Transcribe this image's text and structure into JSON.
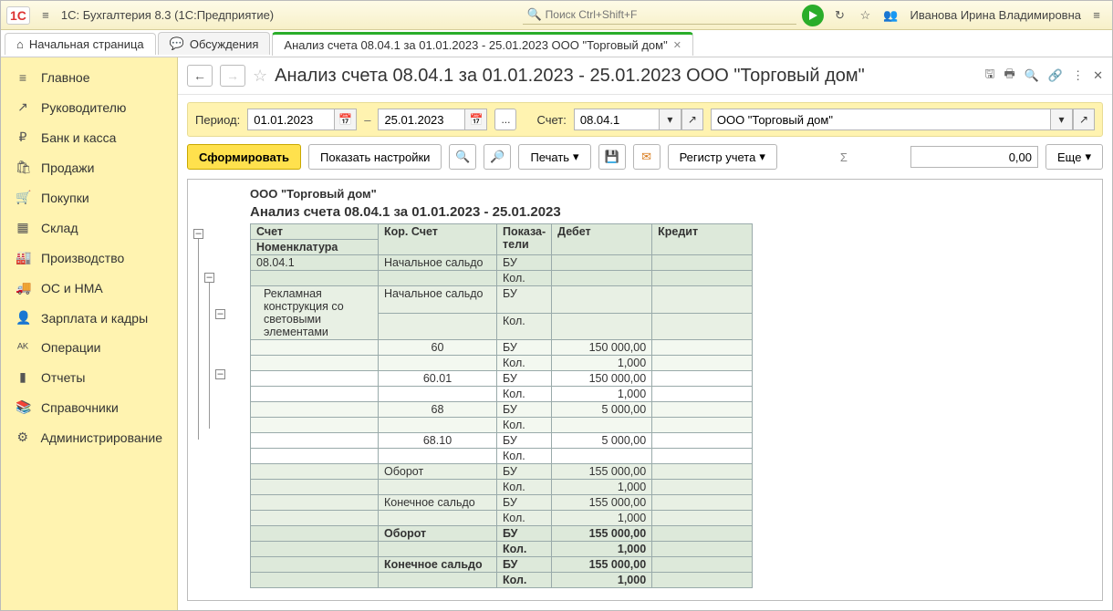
{
  "top": {
    "app_title": "1С: Бухгалтерия 8.3  (1С:Предприятие)",
    "search_placeholder": "Поиск Ctrl+Shift+F",
    "user": "Иванова Ирина Владимировна"
  },
  "tabs": {
    "start": "Начальная страница",
    "discuss": "Обсуждения",
    "active": "Анализ счета 08.04.1 за 01.01.2023 - 25.01.2023 ООО \"Торговый дом\""
  },
  "sidebar": [
    {
      "icon": "≡",
      "label": "Главное"
    },
    {
      "icon": "↗",
      "label": "Руководителю"
    },
    {
      "icon": "₽",
      "label": "Банк и касса"
    },
    {
      "icon": "🛍",
      "label": "Продажи"
    },
    {
      "icon": "🛒",
      "label": "Покупки"
    },
    {
      "icon": "▦",
      "label": "Склад"
    },
    {
      "icon": "🏭",
      "label": "Производство"
    },
    {
      "icon": "🚚",
      "label": "ОС и НМА"
    },
    {
      "icon": "👤",
      "label": "Зарплата и кадры"
    },
    {
      "icon": "ᴬᴷ",
      "label": "Операции"
    },
    {
      "icon": "▮",
      "label": "Отчеты"
    },
    {
      "icon": "📚",
      "label": "Справочники"
    },
    {
      "icon": "⚙",
      "label": "Администрирование"
    }
  ],
  "doc": {
    "title": "Анализ счета 08.04.1 за 01.01.2023 - 25.01.2023 ООО \"Торговый дом\"",
    "period_label": "Период:",
    "date_from": "01.01.2023",
    "date_to": "25.01.2023",
    "dash": "–",
    "ellipsis": "...",
    "account_label": "Счет:",
    "account": "08.04.1",
    "org": "ООО \"Торговый дом\""
  },
  "cmd": {
    "form": "Сформировать",
    "show_settings": "Показать настройки",
    "print": "Печать",
    "register": "Регистр учета",
    "more": "Еще",
    "sum": "0,00"
  },
  "report": {
    "org_title": "ООО \"Торговый дом\"",
    "title": "Анализ счета 08.04.1 за 01.01.2023 - 25.01.2023",
    "headers": {
      "acc1": "Счет",
      "acc2": "Номенклатура",
      "kor": "Кор. Счет",
      "ind": "Показа-тели",
      "deb": "Дебет",
      "cred": "Кредит"
    },
    "rows": [
      {
        "lvl": "0",
        "acc": "08.04.1",
        "kor": "Начальное сальдо",
        "ind": "БУ",
        "deb": "",
        "cred": ""
      },
      {
        "lvl": "0",
        "acc": "",
        "kor": "",
        "ind": "Кол.",
        "deb": "",
        "cred": ""
      },
      {
        "lvl": "1",
        "acc": "Рекламная конструкция со световыми элементами",
        "kor": "Начальное сальдо",
        "ind": "БУ",
        "deb": "",
        "cred": ""
      },
      {
        "lvl": "1",
        "acc": "",
        "kor": "",
        "ind": "Кол.",
        "deb": "",
        "cred": ""
      },
      {
        "lvl": "2",
        "acc": "",
        "kor": "60",
        "ind": "БУ",
        "deb": "150 000,00",
        "cred": ""
      },
      {
        "lvl": "2",
        "acc": "",
        "kor": "",
        "ind": "Кол.",
        "deb": "1,000",
        "cred": ""
      },
      {
        "lvl": "w",
        "acc": "",
        "kor": "60.01",
        "ind": "БУ",
        "deb": "150 000,00",
        "cred": ""
      },
      {
        "lvl": "w",
        "acc": "",
        "kor": "",
        "ind": "Кол.",
        "deb": "1,000",
        "cred": ""
      },
      {
        "lvl": "2",
        "acc": "",
        "kor": "68",
        "ind": "БУ",
        "deb": "5 000,00",
        "cred": ""
      },
      {
        "lvl": "2",
        "acc": "",
        "kor": "",
        "ind": "Кол.",
        "deb": "",
        "cred": ""
      },
      {
        "lvl": "w",
        "acc": "",
        "kor": "68.10",
        "ind": "БУ",
        "deb": "5 000,00",
        "cred": ""
      },
      {
        "lvl": "w",
        "acc": "",
        "kor": "",
        "ind": "Кол.",
        "deb": "",
        "cred": ""
      },
      {
        "lvl": "1",
        "acc": "",
        "kor": "Оборот",
        "ind": "БУ",
        "deb": "155 000,00",
        "cred": ""
      },
      {
        "lvl": "1",
        "acc": "",
        "kor": "",
        "ind": "Кол.",
        "deb": "1,000",
        "cred": ""
      },
      {
        "lvl": "1",
        "acc": "",
        "kor": "Конечное сальдо",
        "ind": "БУ",
        "deb": "155 000,00",
        "cred": ""
      },
      {
        "lvl": "1",
        "acc": "",
        "kor": "",
        "ind": "Кол.",
        "deb": "1,000",
        "cred": ""
      },
      {
        "lvl": "0b",
        "acc": "",
        "kor": "Оборот",
        "ind": "БУ",
        "deb": "155 000,00",
        "cred": ""
      },
      {
        "lvl": "0b",
        "acc": "",
        "kor": "",
        "ind": "Кол.",
        "deb": "1,000",
        "cred": ""
      },
      {
        "lvl": "0b",
        "acc": "",
        "kor": "Конечное сальдо",
        "ind": "БУ",
        "deb": "155 000,00",
        "cred": ""
      },
      {
        "lvl": "0b",
        "acc": "",
        "kor": "",
        "ind": "Кол.",
        "deb": "1,000",
        "cred": ""
      }
    ]
  }
}
